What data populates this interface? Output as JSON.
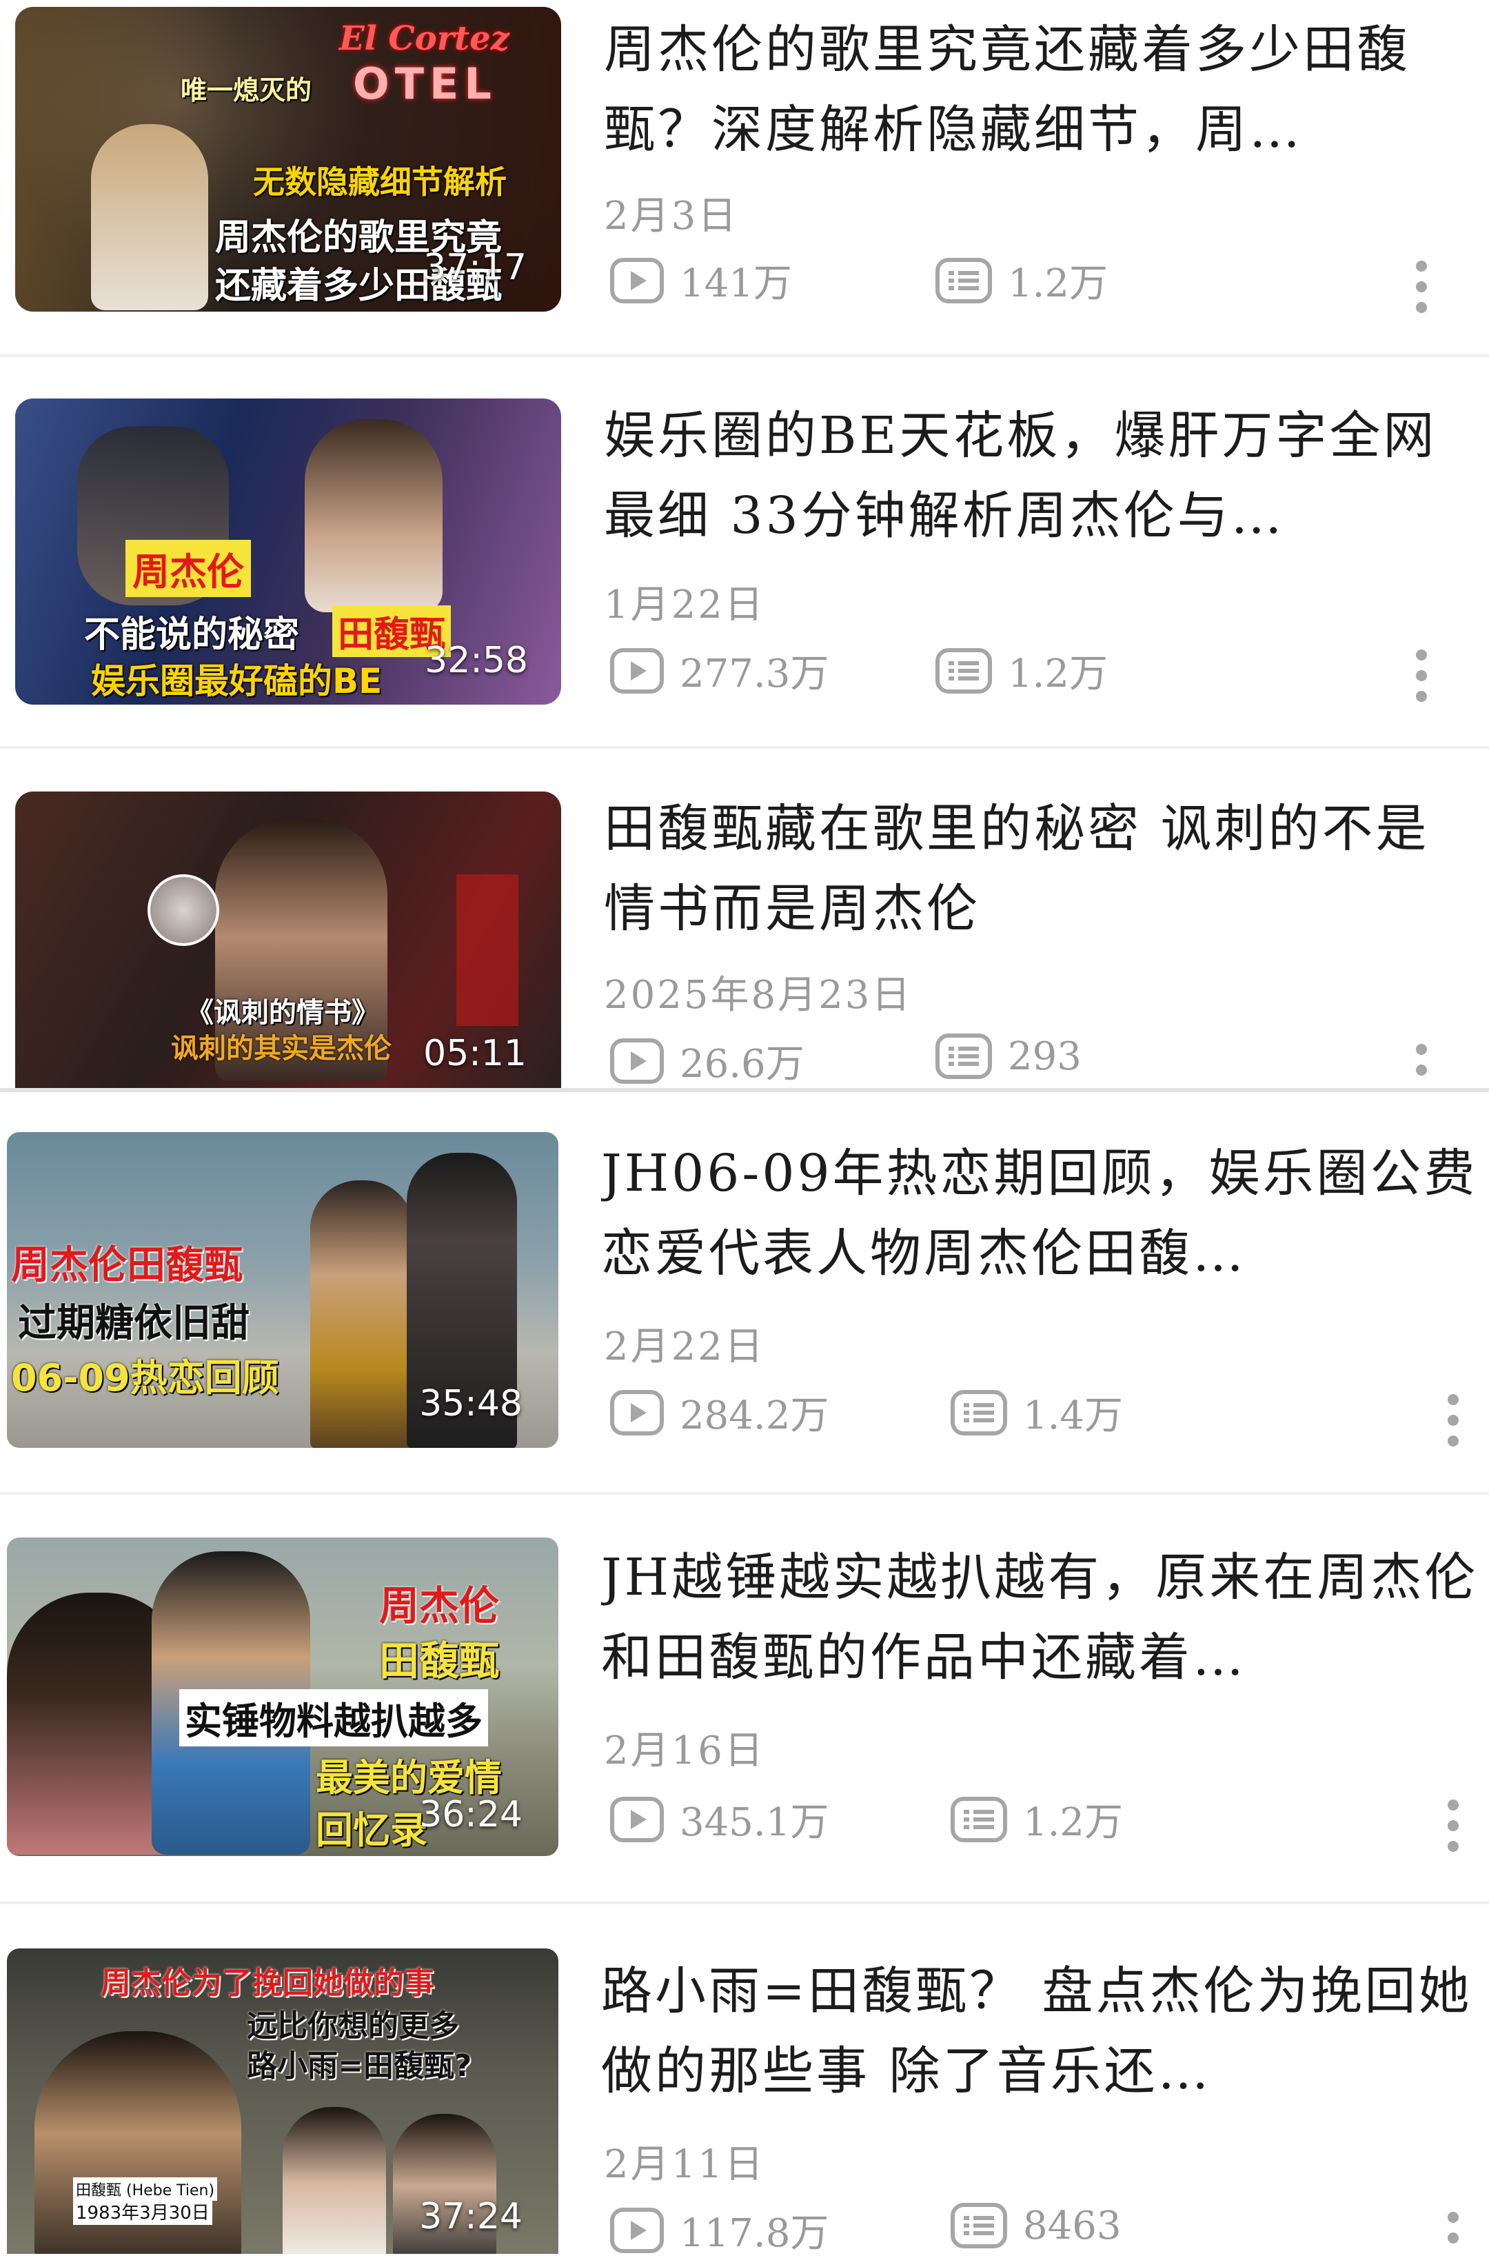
{
  "videos": [
    {
      "title": "周杰伦的歌里究竟还藏着多少田馥甄？深度解析隐藏细节，周…",
      "date": "2月3日",
      "views": "141万",
      "comments": "1.2万",
      "duration": "37:17",
      "overlay": [
        "El Cortez",
        "唯一熄灭的",
        "OTEL",
        "无数隐藏细节解析",
        "周杰伦的歌里究竟",
        "还藏着多少田馥甄"
      ]
    },
    {
      "title": "娱乐圈的BE天花板，爆肝万字全网最细 33分钟解析周杰伦与…",
      "date": "1月22日",
      "views": "277.3万",
      "comments": "1.2万",
      "duration": "32:58",
      "overlay": [
        "周杰伦",
        "不能说的秘密",
        "田馥甄",
        "娱乐圈最好磕的BE"
      ]
    },
    {
      "title": "田馥甄藏在歌里的秘密 讽刺的不是情书而是周杰伦",
      "date": "2025年8月23日",
      "views": "26.6万",
      "comments": "293",
      "duration": "05:11",
      "overlay": [
        "《讽刺的情书》",
        "讽刺的其实是杰伦"
      ]
    },
    {
      "title": "JH06-09年热恋期回顾，娱乐圈公费恋爱代表人物周杰伦田馥…",
      "date": "2月22日",
      "views": "284.2万",
      "comments": "1.4万",
      "duration": "35:48",
      "overlay": [
        "周杰伦田馥甄",
        "过期糖依旧甜",
        "06-09热恋回顾"
      ]
    },
    {
      "title": "JH越锤越实越扒越有，原来在周杰伦和田馥甄的作品中还藏着…",
      "date": "2月16日",
      "views": "345.1万",
      "comments": "1.2万",
      "duration": "36:24",
      "overlay": [
        "周杰伦",
        "田馥甄",
        "实锤物料越扒越多",
        "最美的爱情",
        "回忆录"
      ]
    },
    {
      "title": "路小雨=田馥甄？ 盘点杰伦为挽回她做的那些事 除了音乐还…",
      "date": "2月11日",
      "views": "117.8万",
      "comments": "8463",
      "duration": "37:24",
      "overlay": [
        "周杰伦为了挽回她做的事",
        "远比你想的更多",
        "路小雨=田馥甄?",
        "田馥甄 (Hebe Tien)",
        "1983年3月30日"
      ]
    }
  ],
  "icons": {
    "views": "play-icon",
    "comments": "comment-icon",
    "more": "more-vertical-icon"
  },
  "colors": {
    "text": "#1c1c1c",
    "meta": "#9a9a9a",
    "divider": "#efefef"
  }
}
